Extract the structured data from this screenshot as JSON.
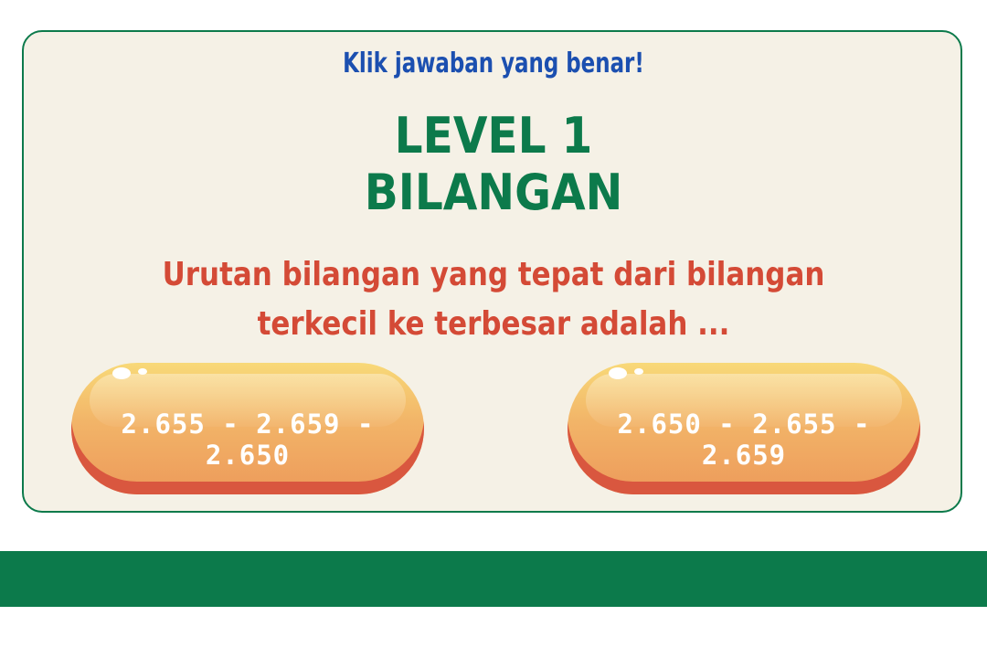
{
  "instruction": "Klik jawaban yang benar!",
  "level": {
    "line1": "LEVEL 1",
    "line2": "BILANGAN"
  },
  "question": "Urutan bilangan yang tepat dari bilangan terkecil ke terbesar adalah ...",
  "answers": [
    {
      "label": "2.655 - 2.659 - 2.650"
    },
    {
      "label": "2.650 - 2.655 - 2.659"
    }
  ],
  "colors": {
    "primary_green": "#0c7a4b",
    "instruction_blue": "#1b4fb0",
    "question_red": "#d44a36",
    "card_background": "#f5f1e6",
    "button_orange": "#f2b468"
  }
}
